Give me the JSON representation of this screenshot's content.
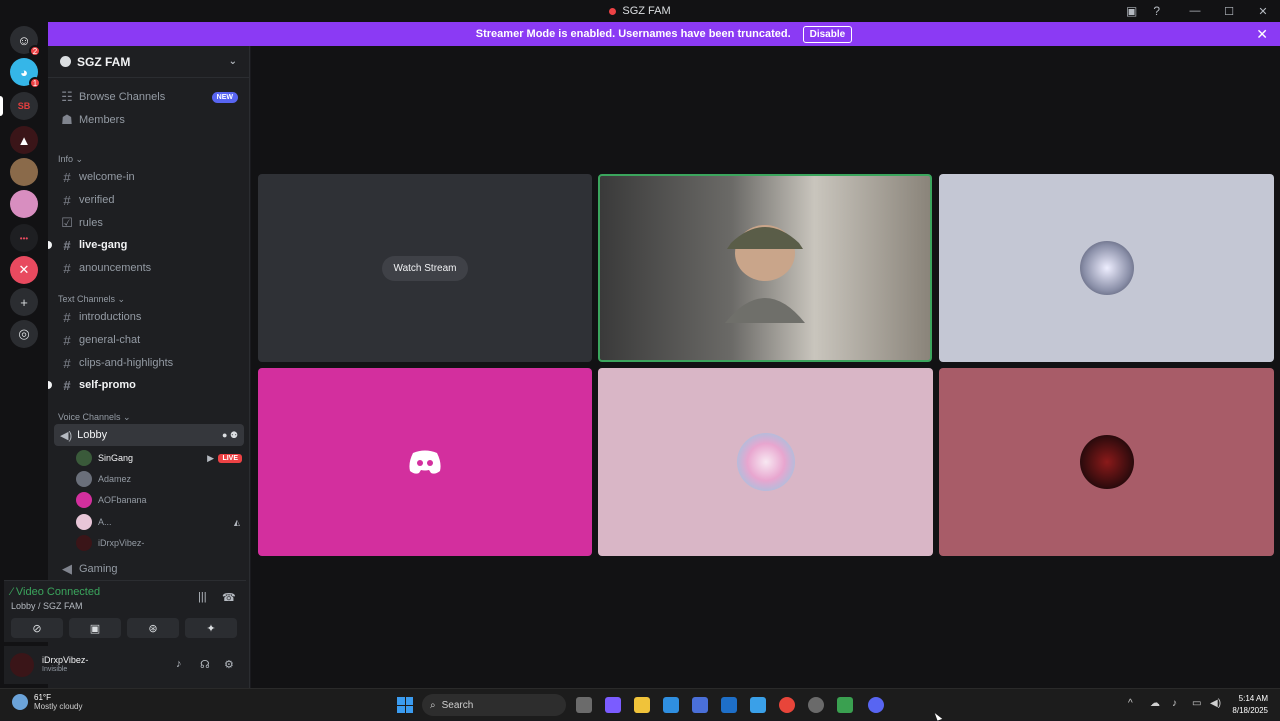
{
  "window": {
    "title": "SGZ FAM",
    "controls": [
      "—",
      "☐",
      "✕"
    ]
  },
  "banner": {
    "text": "Streamer Mode is enabled. Usernames have been truncated.",
    "disable_label": "Disable"
  },
  "guilds": [
    {
      "name": "home",
      "badge": "2",
      "color": "#5865f2"
    },
    {
      "name": "face",
      "badge": "1",
      "color": "#35b6e8"
    },
    {
      "name": "sb",
      "badge": "",
      "color": "#e33e3e"
    },
    {
      "name": "hood",
      "badge": "",
      "color": "#3a1518"
    },
    {
      "name": "art1",
      "badge": "",
      "color": "#8a6a4a"
    },
    {
      "name": "art2",
      "badge": "",
      "color": "#d88ec0"
    },
    {
      "name": "dots",
      "badge": "",
      "color": "#1e1f22"
    },
    {
      "name": "xlogo",
      "badge": "",
      "color": "#e84a5f"
    }
  ],
  "sidebar": {
    "server_name": "SGZ FAM",
    "browse_channels": "Browse Channels",
    "new_badge": "NEW",
    "members": "Members",
    "cat_info": "Info ⌄",
    "info_channels": [
      "welcome-in",
      "verified",
      "rules",
      "live-gang",
      "anouncements"
    ],
    "cat_text": "Text Channels ⌄",
    "text_channels": [
      "introductions",
      "general-chat",
      "clips-and-highlights",
      "self-promo"
    ],
    "cat_voice": "Voice Channels ⌄",
    "lobby": "Lobby",
    "voice_users": [
      {
        "name": "SinGang",
        "live": "LIVE",
        "color": "#3a5a3a"
      },
      {
        "name": "Adamez",
        "live": "",
        "color": "#6a6f7a"
      },
      {
        "name": "AOFbanana",
        "live": "",
        "color": "#d32f9e"
      },
      {
        "name": "A...",
        "live": "",
        "color": "#e8c6d8"
      },
      {
        "name": "iDrxpVibez-",
        "live": "",
        "color": "#3a1518"
      }
    ],
    "gaming": "Gaming"
  },
  "voice_panel": {
    "status": "Video Connected",
    "location": "Lobby / SGZ FAM"
  },
  "user_panel": {
    "name": "iDrxpVibez-",
    "status": "Invisible"
  },
  "stage": {
    "watch_stream": "Watch Stream"
  },
  "tiles": [
    {
      "name": "stream-tile",
      "color": "#2f3136"
    },
    {
      "name": "camera-tile",
      "color": "#4a4a48"
    },
    {
      "name": "tile-3",
      "color": "#c4c7d4"
    },
    {
      "name": "tile-4",
      "color": "#d32f9e"
    },
    {
      "name": "tile-5",
      "color": "#d9b6c6"
    },
    {
      "name": "tile-6",
      "color": "#a85c68"
    }
  ],
  "taskbar": {
    "temp": "61°F",
    "weather": "Mostly cloudy",
    "search_placeholder": "Search",
    "time": "5:14 AM",
    "date": "8/18/2025"
  }
}
